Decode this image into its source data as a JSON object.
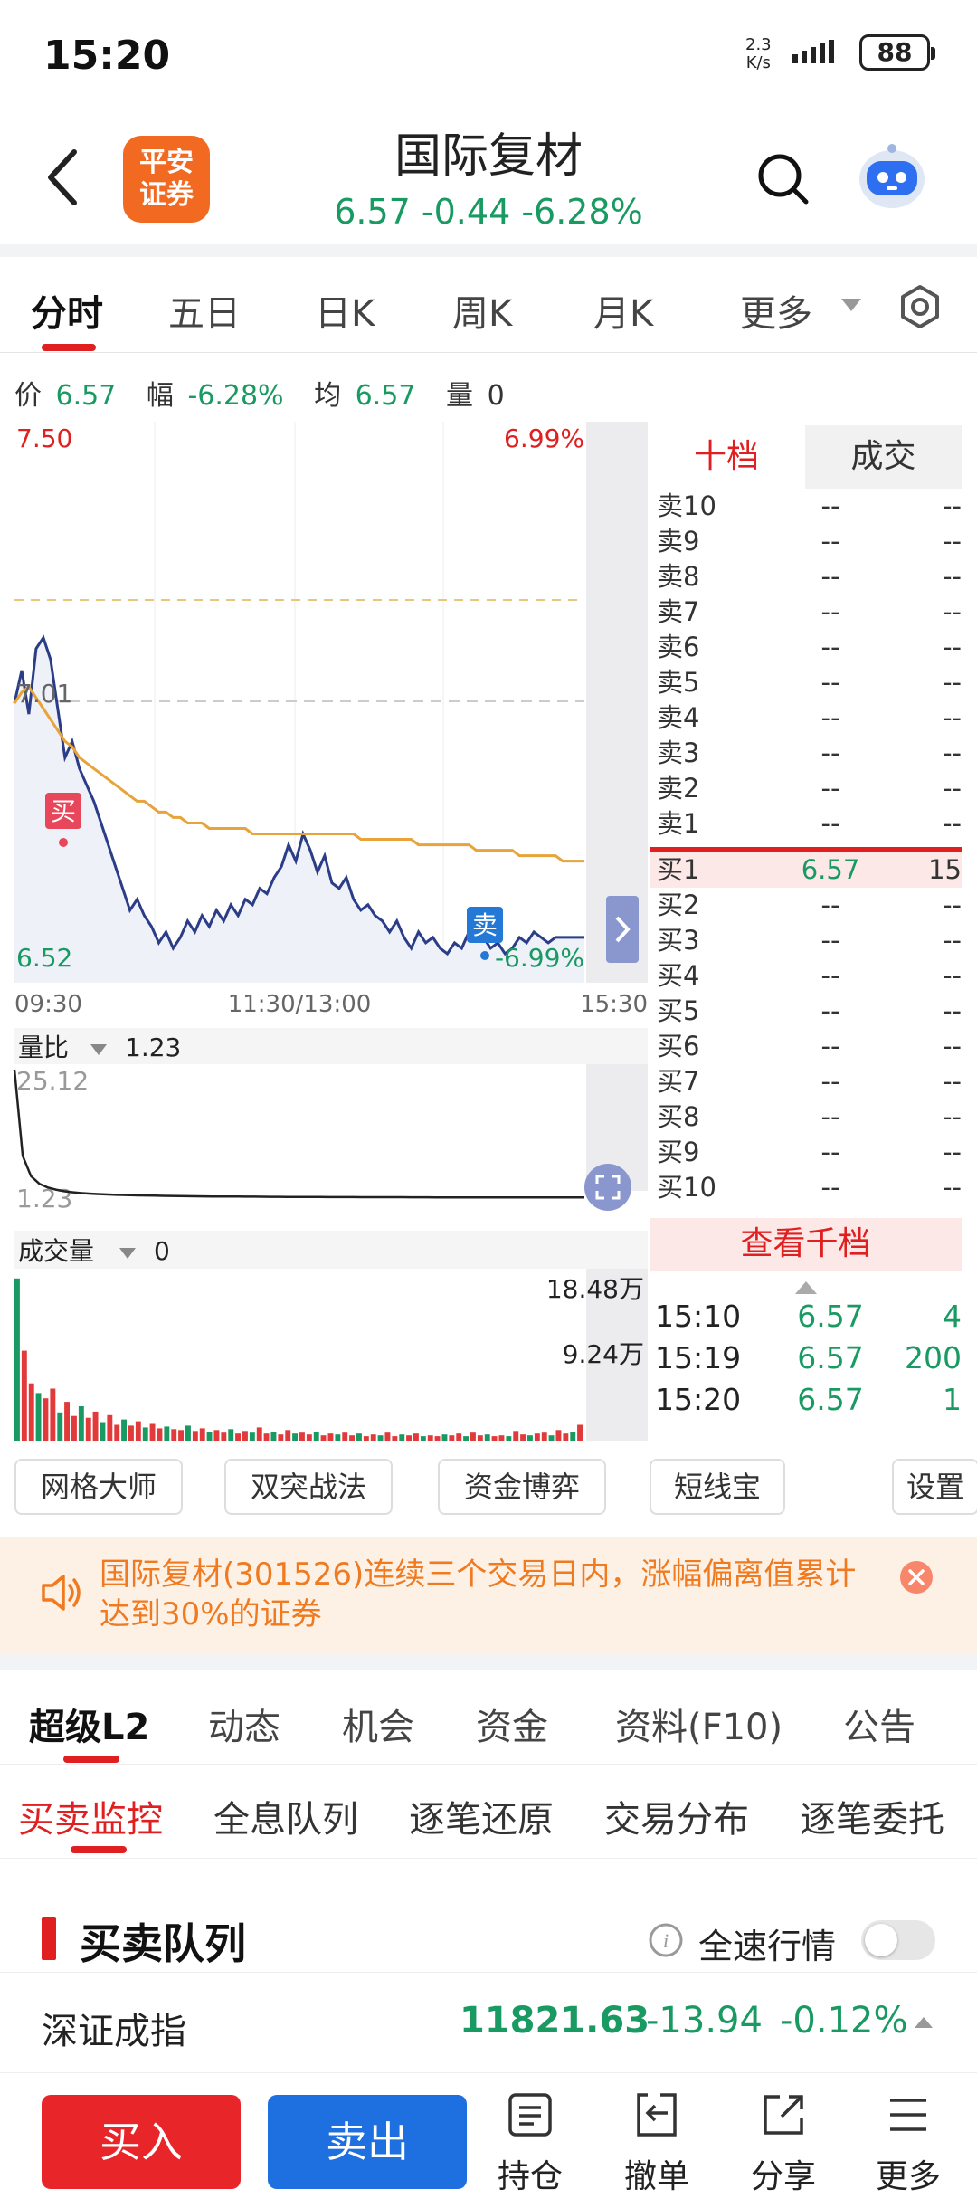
{
  "status_bar": {
    "time": "15:20",
    "net_speed_value": "2.3",
    "net_speed_unit": "K/s",
    "battery": "88"
  },
  "header": {
    "brand": "平安\n证券",
    "title": "国际复材",
    "quote": "6.57 -0.44 -6.28%"
  },
  "chart_tabs": [
    "分时",
    "五日",
    "日K",
    "周K",
    "月K",
    "更多"
  ],
  "price_row": {
    "price_label": "价",
    "price": "6.57",
    "change_label": "幅",
    "change": "-6.28%",
    "avg_label": "均",
    "avg": "6.57",
    "vol_label": "量",
    "vol": "0"
  },
  "chart_data": {
    "type": "line",
    "y_top_label": "7.50",
    "y_top_pct": "6.99%",
    "y_mid_label": "7.01",
    "y_bottom_label": "6.52",
    "y_bottom_pct": "-6.99%",
    "x_labels": [
      "09:30",
      "11:30/13:00",
      "15:30"
    ],
    "ylim": [
      6.52,
      7.5
    ],
    "prev_close": 7.01,
    "series": [
      {
        "values": [
          7.0,
          7.06,
          6.98,
          7.1,
          7.12,
          7.08,
          6.99,
          6.9,
          6.93,
          6.88,
          6.85,
          6.82,
          6.78,
          6.74,
          6.7,
          6.66,
          6.62,
          6.64,
          6.61,
          6.59,
          6.56,
          6.58,
          6.55,
          6.57,
          6.6,
          6.58,
          6.61,
          6.59,
          6.62,
          6.6,
          6.63,
          6.61,
          6.64,
          6.63,
          6.66,
          6.65,
          6.68,
          6.7,
          6.74,
          6.71,
          6.76,
          6.73,
          6.69,
          6.72,
          6.67,
          6.66,
          6.68,
          6.64,
          6.62,
          6.63,
          6.61,
          6.6,
          6.58,
          6.6,
          6.57,
          6.55,
          6.58,
          6.56,
          6.57,
          6.55,
          6.54,
          6.56,
          6.55,
          6.58,
          6.6,
          6.57,
          6.55,
          6.56,
          6.54,
          6.55,
          6.57,
          6.56,
          6.58,
          6.57,
          6.56,
          6.57,
          6.57,
          6.57,
          6.57,
          6.57
        ]
      },
      {
        "values": [
          7.0,
          7.02,
          7.03,
          7.01,
          6.99,
          6.97,
          6.95,
          6.93,
          6.92,
          6.9,
          6.89,
          6.88,
          6.87,
          6.86,
          6.85,
          6.84,
          6.83,
          6.82,
          6.82,
          6.81,
          6.8,
          6.8,
          6.79,
          6.79,
          6.78,
          6.78,
          6.78,
          6.77,
          6.77,
          6.77,
          6.77,
          6.77,
          6.77,
          6.76,
          6.76,
          6.76,
          6.76,
          6.76,
          6.76,
          6.76,
          6.76,
          6.76,
          6.76,
          6.76,
          6.76,
          6.76,
          6.76,
          6.76,
          6.75,
          6.75,
          6.75,
          6.75,
          6.75,
          6.75,
          6.75,
          6.75,
          6.74,
          6.74,
          6.74,
          6.74,
          6.74,
          6.74,
          6.74,
          6.74,
          6.73,
          6.73,
          6.73,
          6.73,
          6.73,
          6.73,
          6.72,
          6.72,
          6.72,
          6.72,
          6.72,
          6.72,
          6.71,
          6.71,
          6.71,
          6.71
        ]
      }
    ],
    "buy_marker": "买",
    "sell_marker": "卖",
    "ratio_label": "量比",
    "ratio_value": "1.23",
    "ratio_top": "25.12",
    "ratio_bottom": "1.23",
    "ratio_values": [
      25.12,
      9.0,
      5.2,
      3.8,
      3.1,
      2.7,
      2.4,
      2.2,
      2.05,
      1.95,
      1.86,
      1.8,
      1.74,
      1.7,
      1.66,
      1.62,
      1.59,
      1.56,
      1.53,
      1.51,
      1.49,
      1.47,
      1.45,
      1.43,
      1.42,
      1.41,
      1.4,
      1.39,
      1.38,
      1.37,
      1.36,
      1.35,
      1.34,
      1.33,
      1.33,
      1.32,
      1.31,
      1.31,
      1.3,
      1.3,
      1.29,
      1.29,
      1.28,
      1.28,
      1.28,
      1.27,
      1.27,
      1.27,
      1.26,
      1.26,
      1.26,
      1.25,
      1.25,
      1.25,
      1.25,
      1.24,
      1.24,
      1.24,
      1.24,
      1.24,
      1.23,
      1.23,
      1.23,
      1.23,
      1.23,
      1.23,
      1.23,
      1.23,
      1.23,
      1.23
    ],
    "vol_label": "成交量",
    "vol_value": "0",
    "vol_top": "18.48万",
    "vol_mid": "9.24万",
    "volumes": [
      18.4,
      10.2,
      6.5,
      5.4,
      4.8,
      5.9,
      3.2,
      4.4,
      2.8,
      3.9,
      2.6,
      3.3,
      2.1,
      2.9,
      1.8,
      2.4,
      1.7,
      2.2,
      1.5,
      1.9,
      1.4,
      1.6,
      1.3,
      1.2,
      1.7,
      1.1,
      1.4,
      1.0,
      1.2,
      0.9,
      1.3,
      0.8,
      1.1,
      0.9,
      1.5,
      0.8,
      1.0,
      0.7,
      1.2,
      0.8,
      0.9,
      0.7,
      1.0,
      0.6,
      0.8,
      0.7,
      0.9,
      0.6,
      0.8,
      0.5,
      0.7,
      0.6,
      0.9,
      0.5,
      0.7,
      0.6,
      0.8,
      0.5,
      0.6,
      0.5,
      0.7,
      0.6,
      0.8,
      0.5,
      0.9,
      0.6,
      0.7,
      0.5,
      0.6,
      0.5,
      1.1,
      0.7,
      0.6,
      0.8,
      0.9,
      0.6,
      1.2,
      0.8,
      1.0,
      1.8
    ]
  },
  "orderbook": {
    "tabs": [
      "十档",
      "成交"
    ],
    "asks": [
      "卖10",
      "卖9",
      "卖8",
      "卖7",
      "卖6",
      "卖5",
      "卖4",
      "卖3",
      "卖2",
      "卖1"
    ],
    "bids": [
      "买1",
      "买2",
      "买3",
      "买4",
      "买5",
      "买6",
      "买7",
      "买8",
      "买9",
      "买10"
    ],
    "empty": "--",
    "bid1_price": "6.57",
    "bid1_vol": "15",
    "more": "查看千档",
    "ticks": [
      {
        "time": "15:10",
        "price": "6.57",
        "vol": "4"
      },
      {
        "time": "15:19",
        "price": "6.57",
        "vol": "200"
      },
      {
        "time": "15:20",
        "price": "6.57",
        "vol": "1"
      }
    ]
  },
  "tools": [
    "网格大师",
    "双突战法",
    "资金博弈",
    "短线宝",
    "设置"
  ],
  "notice": "国际复材(301526)连续三个交易日内，涨幅偏离值累计达到30%的证券",
  "main_tabs": [
    "超级L2",
    "动态",
    "机会",
    "资金",
    "资料(F10)",
    "公告"
  ],
  "sub_tabs": [
    "买卖监控",
    "全息队列",
    "逐笔还原",
    "交易分布",
    "逐笔委托"
  ],
  "queue": {
    "title": "买卖队列",
    "fullspeed": "全速行情"
  },
  "index": {
    "name": "深证成指",
    "value": "11821.63",
    "change": "-13.94",
    "pct": "-0.12%"
  },
  "bottom": {
    "buy": "买入",
    "sell": "卖出",
    "hold": "持仓",
    "cancel": "撤单",
    "share": "分享",
    "more": "更多"
  },
  "colors": {
    "red": "#e02020",
    "green": "#1a9a63",
    "orange": "#f07a20",
    "blue": "#1e6fe0",
    "price_line": "#2b3d87",
    "avg_line": "#e8a33a"
  }
}
